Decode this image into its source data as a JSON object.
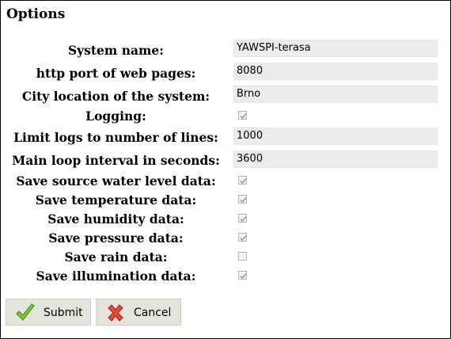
{
  "page": {
    "title": "Options"
  },
  "fields": {
    "system_name": {
      "label": "System name:",
      "value": "YAWSPI-terasa"
    },
    "http_port": {
      "label": "http port of web pages:",
      "value": "8080"
    },
    "city_location": {
      "label": "City location of the system:",
      "value": "Brno"
    },
    "logging": {
      "label": "Logging:",
      "checked": true
    },
    "limit_logs": {
      "label": "Limit logs to number of lines:",
      "value": "1000"
    },
    "main_loop_interval": {
      "label": "Main loop interval in seconds:",
      "value": "3600"
    },
    "save_source_water": {
      "label": "Save source water level data:",
      "checked": true
    },
    "save_temperature": {
      "label": "Save temperature data:",
      "checked": true
    },
    "save_humidity": {
      "label": "Save humidity data:",
      "checked": true
    },
    "save_pressure": {
      "label": "Save pressure data:",
      "checked": true
    },
    "save_rain": {
      "label": "Save rain data:",
      "checked": false
    },
    "save_illumination": {
      "label": "Save illumination data:",
      "checked": true
    }
  },
  "buttons": {
    "submit_label": "Submit",
    "cancel_label": "Cancel"
  },
  "icons": {
    "submit": "checkmark-icon",
    "cancel": "cross-icon"
  },
  "colors": {
    "input_bg": "#ececec",
    "button_bg": "#e4e4dc",
    "check_green": "#6bbf2a",
    "cross_red": "#e0443a"
  }
}
